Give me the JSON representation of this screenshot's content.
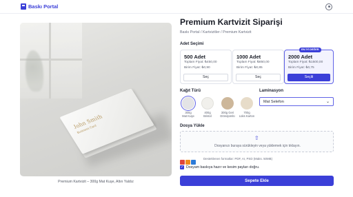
{
  "header": {
    "brand": "Baskı Portal",
    "logo_icon": "printer-logo-icon",
    "user_icon": "user-icon"
  },
  "product": {
    "title": "Premium Kartvizit Siparişi",
    "breadcrumb": "Baskı Portal / Kartvizitler / Premium Kartvizit",
    "image": {
      "card_name": "John Smith",
      "card_subtitle": "Business Card"
    },
    "caption": "Premium Kartvizit – 300g Mat Kuşe, Altın Yaldız"
  },
  "quantity": {
    "heading": "Adet Seçimi",
    "options": [
      {
        "title": "500 Adet",
        "total": "Toplam Fiyat: ₺450,00",
        "unit": "Birim Fiyat: ₺0,90",
        "button": "Seç",
        "selected": false
      },
      {
        "title": "1000 Adet",
        "total": "Toplam Fiyat: ₺850,00",
        "unit": "Birim Fiyat: ₺0,85",
        "button": "Seç",
        "selected": false
      },
      {
        "title": "2000 Adet",
        "total": "Toplam Fiyat: ₺1500,00",
        "unit": "Birim Fiyat: ₺0,75",
        "button": "Seçili",
        "selected": true,
        "badge": "EN İYİ DEĞER"
      }
    ]
  },
  "paper": {
    "heading": "Kağıt Türü",
    "options": [
      {
        "line1": "300g",
        "line2": "Mat Kuşe",
        "color": "#e4e4e6",
        "selected": true
      },
      {
        "line1": "400g",
        "line2": "Bristol",
        "color": "#f1f0ec",
        "selected": false
      },
      {
        "line1": "300g Geri",
        "line2": "Dönüşümlü",
        "color": "#cdb79a",
        "selected": false
      },
      {
        "line1": "700g",
        "line2": "Lüks Karton",
        "color": "#e7dcc9",
        "selected": false
      }
    ]
  },
  "lamination": {
    "heading": "Laminasyon",
    "value": "Mat Selefon"
  },
  "upload": {
    "heading": "Dosya Yükle",
    "icon": "upload-icon",
    "text": "Dosyanızı buraya sürükleyin veya yüklemek için tıklayın.",
    "formats_text": "Desteklenen formatlar: PDF, AI, PSD (Maks. 50MB)",
    "format_colors": [
      "#e0463c",
      "#f08c1e",
      "#2d7bd8"
    ]
  },
  "confirm": {
    "checked": true,
    "label": "Dosyam baskıya hazır ve kesim payları doğru."
  },
  "cta": {
    "label": "Sepete Ekle"
  },
  "colors": {
    "accent": "#3b3fd8"
  }
}
